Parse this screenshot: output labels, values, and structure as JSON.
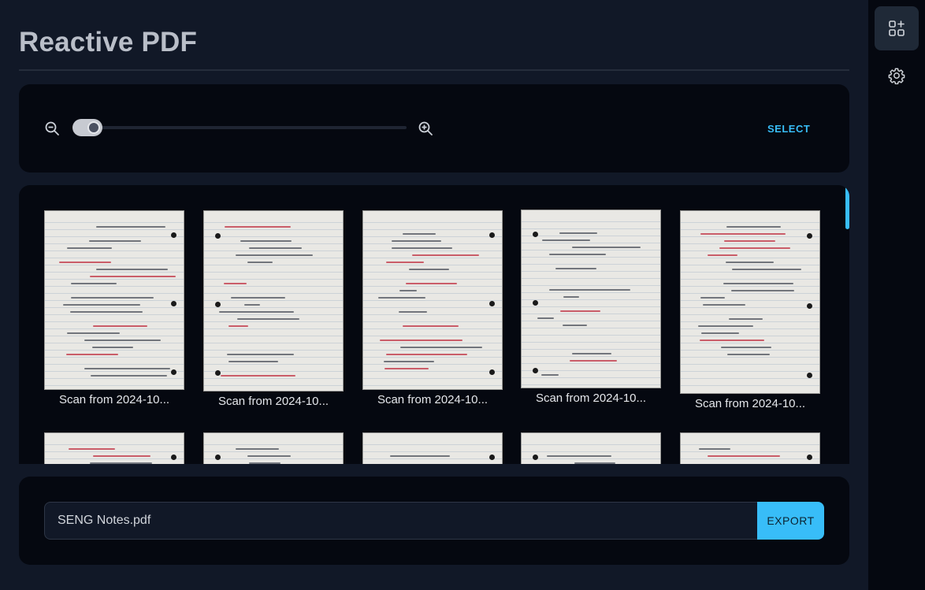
{
  "header": {
    "title": "Reactive PDF"
  },
  "toolbar": {
    "zoom_out_icon": "zoom-out-icon",
    "zoom_in_icon": "zoom-in-icon",
    "zoom_level": 0.09,
    "select_label": "SELECT"
  },
  "gallery": {
    "scans": [
      {
        "label": "Scan from 2024-10..."
      },
      {
        "label": "Scan from 2024-10..."
      },
      {
        "label": "Scan from 2024-10..."
      },
      {
        "label": "Scan from 2024-10..."
      },
      {
        "label": "Scan from 2024-10..."
      }
    ],
    "scroll_position": 0
  },
  "export": {
    "filename": "SENG Notes.pdf",
    "export_label": "EXPORT"
  },
  "sidebar": {
    "items": [
      {
        "icon": "grid-plus-icon",
        "active": true
      },
      {
        "icon": "gear-icon",
        "active": false
      }
    ]
  },
  "colors": {
    "accent": "#38bdf8",
    "panel": "#050810",
    "background": "#111827"
  }
}
